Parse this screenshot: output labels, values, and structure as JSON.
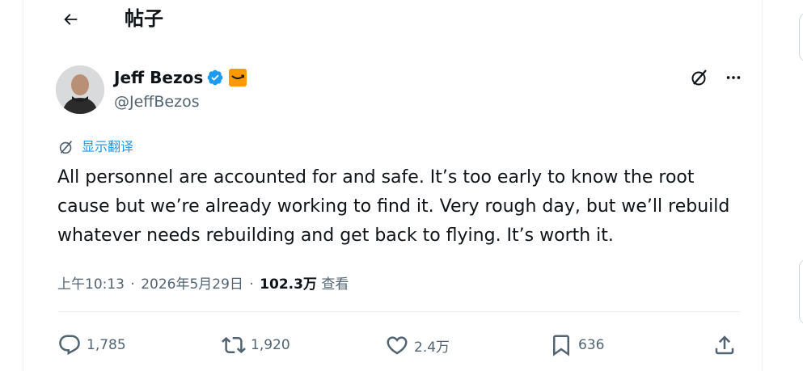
{
  "header": {
    "title": "帖子"
  },
  "author": {
    "display_name": "Jeff Bezos",
    "handle": "@JeffBezos",
    "verified": true,
    "affiliate": "amazon-smile-icon"
  },
  "translate": {
    "label": "显示翻译"
  },
  "tweet": {
    "text": "All personnel are accounted for and safe. It’s too early to know the root cause but we’re already working to find it. Very rough day, but we’ll rebuild whatever needs rebuilding and get back to flying. It’s worth it."
  },
  "meta": {
    "time": "上午10:13",
    "separator": "·",
    "date": "2026年5月29日",
    "views_count": "102.3万",
    "views_label": "查看"
  },
  "actions": {
    "replies": "1,785",
    "reposts": "1,920",
    "likes": "2.4万",
    "bookmarks": "636"
  },
  "colors": {
    "accent": "#1d9bf0",
    "secondary_text": "#536471",
    "primary_text": "#0f1419",
    "amazon_orange": "#ff9900",
    "border": "#eff3f4"
  }
}
